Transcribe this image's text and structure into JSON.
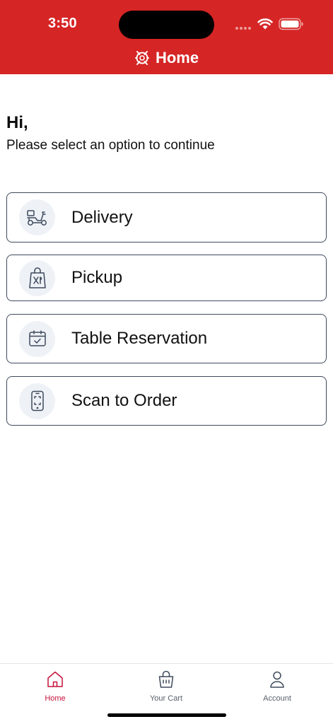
{
  "status_bar": {
    "time": "3:50"
  },
  "nav": {
    "title": "Home"
  },
  "greeting": {
    "title": "Hi,",
    "subtitle": "Please select an option to continue"
  },
  "options": [
    {
      "label": "Delivery",
      "icon": "scooter-icon"
    },
    {
      "label": "Pickup",
      "icon": "shopping-bag-utensils-icon"
    },
    {
      "label": "Table Reservation",
      "icon": "calendar-check-icon"
    },
    {
      "label": "Scan to Order",
      "icon": "phone-scan-icon"
    }
  ],
  "tabbar": {
    "tabs": [
      {
        "label": "Home",
        "icon": "home-icon",
        "active": true
      },
      {
        "label": "Your Cart",
        "icon": "cart-bag-icon",
        "active": false
      },
      {
        "label": "Account",
        "icon": "user-icon",
        "active": false
      }
    ]
  },
  "colors": {
    "brand": "#d62525",
    "active_tab": "#c6133b",
    "icon_stroke": "#3e4a5c",
    "icon_bg": "#eef2f7"
  }
}
